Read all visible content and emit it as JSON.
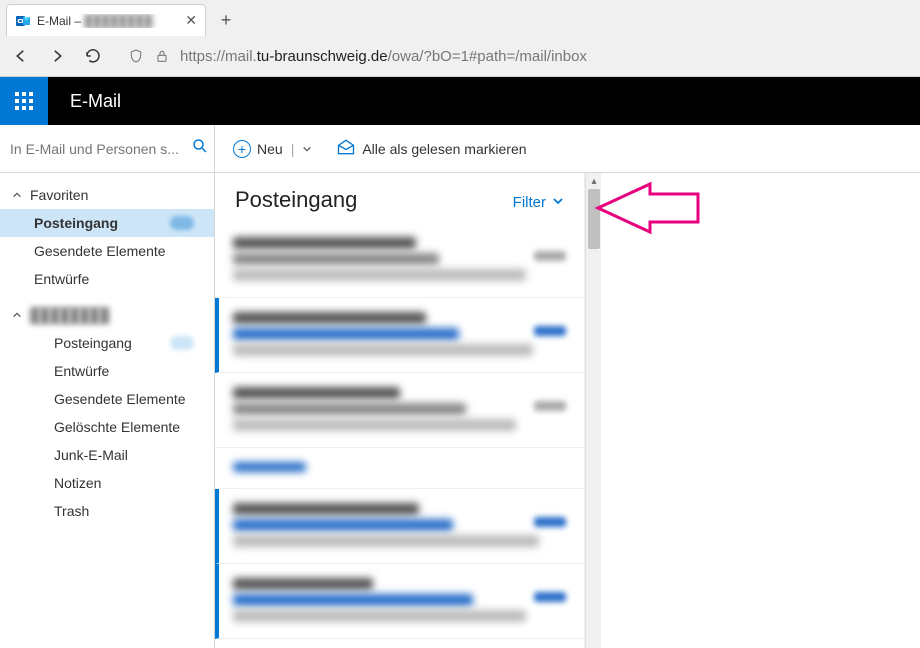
{
  "browser": {
    "tab_title_prefix": "E-Mail –",
    "tab_title_blurred": "████████",
    "close_glyph": "✕",
    "new_tab_glyph": "+",
    "url_prefix": "https://mail.",
    "url_host": "tu-braunschweig.de",
    "url_path": "/owa/?bO=1#path=/mail/inbox"
  },
  "app": {
    "title": "E-Mail"
  },
  "sidebar": {
    "search_placeholder": "In E-Mail und Personen s...",
    "favorites_label": "Favoriten",
    "favorites": [
      {
        "label": "Posteingang",
        "active": true,
        "badge": true
      },
      {
        "label": "Gesendete Elemente"
      },
      {
        "label": "Entwürfe"
      }
    ],
    "account_label_blurred": "████████",
    "folders": [
      {
        "label": "Posteingang",
        "badge": true
      },
      {
        "label": "Entwürfe"
      },
      {
        "label": "Gesendete Elemente"
      },
      {
        "label": "Gelöschte Elemente"
      },
      {
        "label": "Junk-E-Mail"
      },
      {
        "label": "Notizen"
      },
      {
        "label": "Trash"
      }
    ]
  },
  "toolbar": {
    "new_label": "Neu",
    "mark_all_read_label": "Alle als gelesen markieren"
  },
  "list": {
    "heading": "Posteingang",
    "filter_label": "Filter"
  }
}
